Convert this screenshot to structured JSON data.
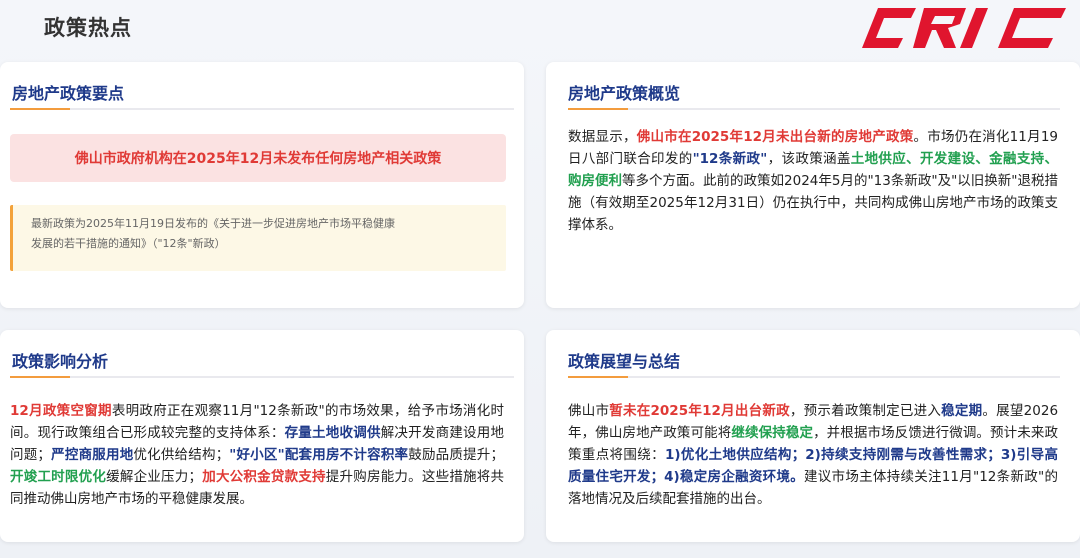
{
  "page": {
    "title": "政策热点"
  },
  "logo": {
    "text": "CRIC"
  },
  "colors": {
    "accent_orange": "#f39c3d",
    "title_blue": "#1f3a8a",
    "red": "#e03a36",
    "green": "#22a050",
    "logo_red": "#e0152e"
  },
  "key_points": {
    "title": "房地产政策要点",
    "highlight": "佛山市政府机构在2025年12月未发布任何房地产相关政策",
    "note_line1": "最新政策为2025年11月19日发布的《关于进一步促进房地产市场平稳健康",
    "note_line2": "发展的若干措施的通知》（\"12条\"新政）"
  },
  "overview": {
    "title": "房地产政策概览",
    "t1": "数据显示，",
    "r1": "佛山市在2025年12月未出台新的房地产政策",
    "t2": "。市场仍在消化11月19日八部门联合印发的",
    "b1": "\"12条新政\"",
    "t3": "，该政策涵盖",
    "g1": "土地供应、开发建设、金融支持、购房便利",
    "t4": "等多个方面。此前的政策如2024年5月的\"13条新政\"及\"以旧换新\"退税措施（有效期至2025年12月31日）仍在执行中，共同构成佛山房地产市场的政策支撑体系。"
  },
  "impact": {
    "title": "政策影响分析",
    "r1": "12月政策空窗期",
    "t1": "表明政府正在观察11月\"12条新政\"的市场效果，给予市场消化时间。现行政策组合已形成较完整的支持体系：",
    "b1": "存量土地收调供",
    "t2": "解决开发商建设用地问题；",
    "b2": "严控商服用地",
    "t3": "优化供给结构；",
    "b3": "\"好小区\"配套用房不计容积率",
    "t4": "鼓励品质提升；",
    "g1": "开竣工时限优化",
    "t5": "缓解企业压力；",
    "r2": "加大公积金贷款支持",
    "t6": "提升购房能力。这些措施将共同推动佛山房地产市场的平稳健康发展。"
  },
  "outlook": {
    "title": "政策展望与总结",
    "t1": "佛山市",
    "r1": "暂未在2025年12月出台新政",
    "t2": "，预示着政策制定已进入",
    "b1": "稳定期",
    "t3": "。展望2026年，佛山房地产政策可能将",
    "g1": "继续保持稳定",
    "t4": "，并根据市场反馈进行微调。预计未来政策重点将围绕：",
    "b2": "1)优化土地供应结构；2)持续支持刚需与改善性需求；3)引导高质量住宅开发；4)稳定房企融资环境。",
    "t5": "建议市场主体持续关注11月\"12条新政\"的落地情况及后续配套措施的出台。"
  }
}
